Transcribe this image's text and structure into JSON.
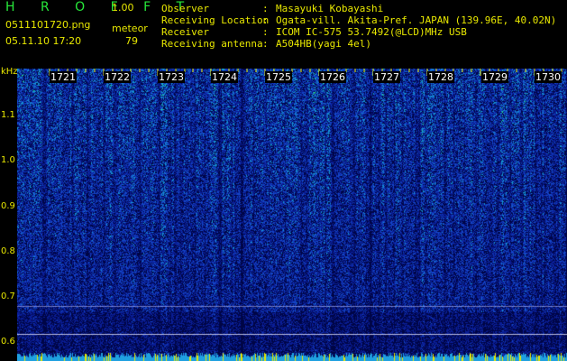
{
  "app": {
    "title": "H R O F F T",
    "version": "1.00"
  },
  "file": {
    "name": "0511101720.png",
    "datetime": "05.11.10 17:20"
  },
  "meteor": {
    "label": "meteor",
    "count": "79"
  },
  "info": [
    {
      "key": "Observer",
      "value": "Masayuki Kobayashi"
    },
    {
      "key": "Receiving Location",
      "value": "Ogata-vill. Akita-Pref. JAPAN (139.96E, 40.02N)"
    },
    {
      "key": "Receiver",
      "value": "ICOM IC-575 53.7492(@LCD)MHz USB"
    },
    {
      "key": "Receiving antenna",
      "value": "A504HB(yagi 4el)"
    }
  ],
  "axis": {
    "unit": "kHz",
    "freq_ticks": [
      "1.1",
      "1.0",
      "0.9",
      "0.8",
      "0.7",
      "0.6"
    ],
    "time_ticks": [
      "1721",
      "1722",
      "1723",
      "1724",
      "1725",
      "1726",
      "1727",
      "1728",
      "1729",
      "1730"
    ]
  },
  "colors": {
    "label_yellow": "#e8e800",
    "title_green": "#27e83a",
    "background": "#000000",
    "signal_base": "#0a1a7a"
  }
}
